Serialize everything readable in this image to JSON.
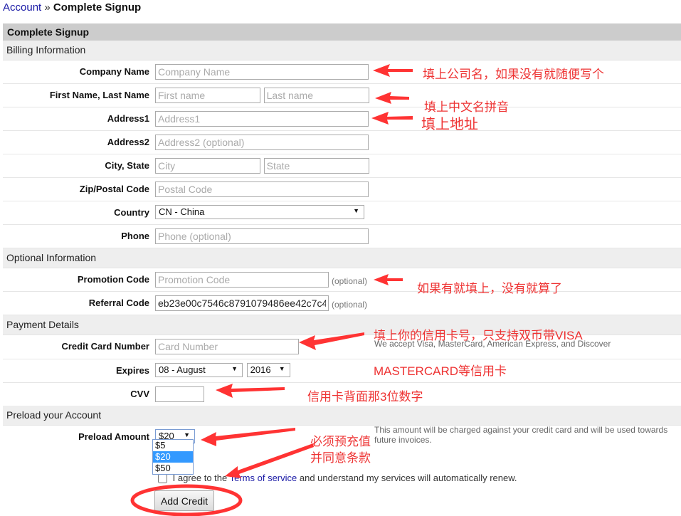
{
  "breadcrumb": {
    "parent": "Account",
    "separator": "»",
    "current": "Complete Signup"
  },
  "panel": {
    "title": "Complete Signup"
  },
  "billing": {
    "section_title": "Billing Information",
    "company": {
      "label": "Company Name",
      "placeholder": "Company Name",
      "value": ""
    },
    "name": {
      "label": "First Name, Last Name",
      "first_placeholder": "First name",
      "last_placeholder": "Last name"
    },
    "address1": {
      "label": "Address1",
      "placeholder": "Address1"
    },
    "address2": {
      "label": "Address2",
      "placeholder": "Address2 (optional)"
    },
    "city_state": {
      "label": "City, State",
      "city_placeholder": "City",
      "state_placeholder": "State"
    },
    "zip": {
      "label": "Zip/Postal Code",
      "placeholder": "Postal Code"
    },
    "country": {
      "label": "Country",
      "selected": "CN - China"
    },
    "phone": {
      "label": "Phone",
      "placeholder": "Phone (optional)"
    }
  },
  "optional": {
    "section_title": "Optional Information",
    "promo": {
      "label": "Promotion Code",
      "placeholder": "Promotion Code",
      "note": "(optional)"
    },
    "referral": {
      "label": "Referral Code",
      "value": "eb23e00c7546c8791079486ee42c7c4",
      "note": "(optional)"
    }
  },
  "payment": {
    "section_title": "Payment Details",
    "card": {
      "label": "Credit Card Number",
      "placeholder": "Card Number",
      "helper": "We accept Visa, MasterCard, American Express, and Discover"
    },
    "expires": {
      "label": "Expires",
      "month": "08 - August",
      "year": "2016"
    },
    "cvv": {
      "label": "CVV",
      "value": ""
    }
  },
  "preload": {
    "section_title": "Preload your Account",
    "amount": {
      "label": "Preload Amount",
      "selected": "$20",
      "options": [
        "$5",
        "$20",
        "$50"
      ]
    },
    "helper": "This amount will be charged against your credit card and will be used towards future invoices.",
    "agree_prefix": "I agree to the ",
    "agree_link": "Terms of service",
    "agree_suffix": " and understand my services will automatically renew.",
    "submit_label": "Add Credit"
  },
  "annotations": {
    "company": "填上公司名，如果没有就随便写个",
    "name": "填上中文名拼音",
    "address": "填上地址",
    "promo": "如果有就填上，没有就算了",
    "card_line1": "填上你的信用卡号，只支持双币带VISA",
    "card_line2": "MASTERCARD等信用卡",
    "cvv": "信用卡背面那3位数字",
    "preload_line1": "必须预充值",
    "preload_line2": "并同意条款",
    "color": "#ee3333"
  }
}
